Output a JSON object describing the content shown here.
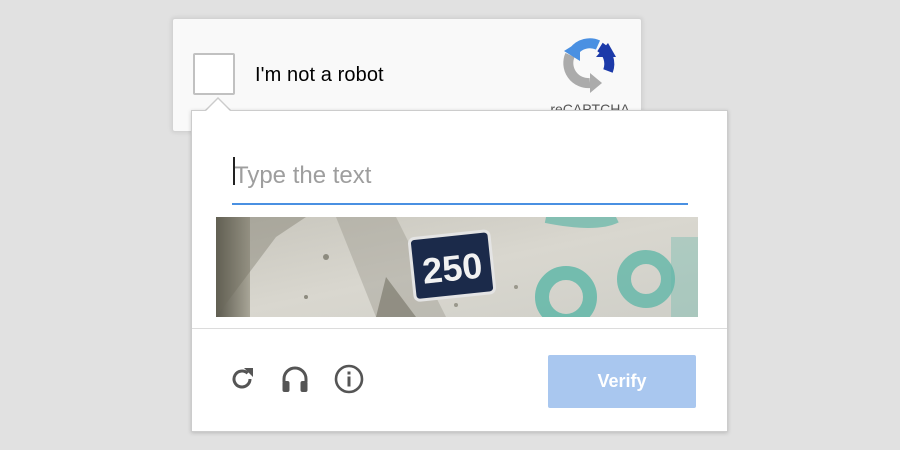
{
  "widget": {
    "checkbox_label": "I'm not a robot",
    "logo_text": "reCAPTCHA",
    "logo_icon": "recaptcha-logo-icon"
  },
  "challenge": {
    "input": {
      "value": "",
      "placeholder": "Type the text"
    },
    "image": {
      "text": "250"
    },
    "controls": {
      "reload_icon": "reload-icon",
      "audio_icon": "headphones-icon",
      "info_icon": "info-icon"
    },
    "verify_label": "Verify"
  },
  "colors": {
    "accent": "#4a90e2",
    "verify_button": "#a9c7ef",
    "logo_blue": "#1c3aa9",
    "logo_light_blue": "#4a90e2",
    "logo_gray": "#ababab"
  }
}
